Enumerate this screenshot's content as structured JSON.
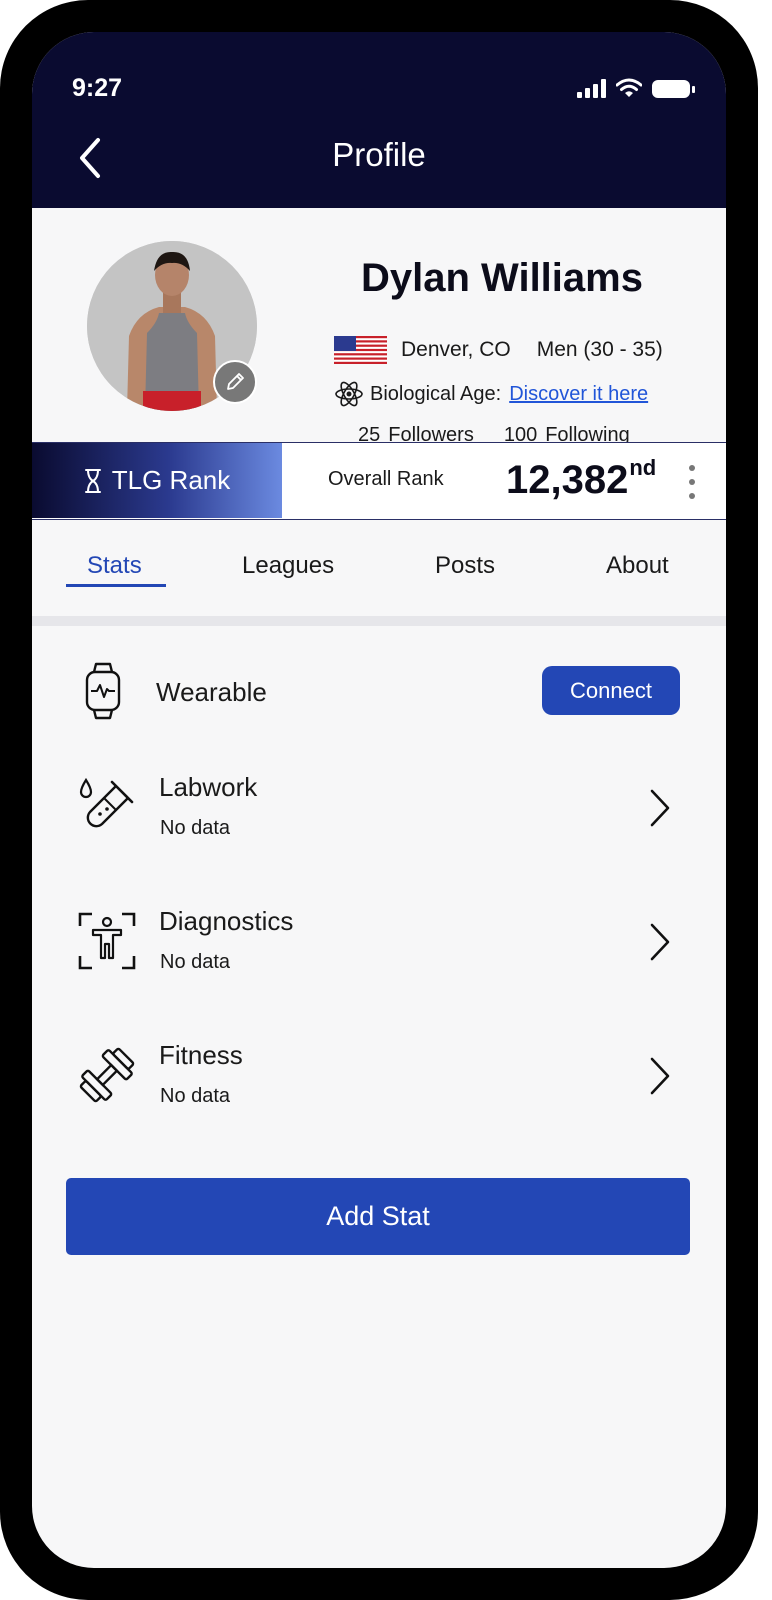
{
  "status_bar": {
    "time": "9:27"
  },
  "header": {
    "title": "Profile"
  },
  "profile": {
    "name": "Dylan Williams",
    "location": "Denver, CO",
    "age_group": "Men (30 - 35)",
    "bio_age_label": "Biological Age:",
    "bio_age_link": "Discover it here",
    "followers_count": "25",
    "followers_label": "Followers",
    "following_count": "100",
    "following_label": "Following"
  },
  "rank": {
    "label": "TLG Rank",
    "overall_label": "Overall Rank",
    "value": "12,382",
    "suffix": "nd"
  },
  "tabs": [
    {
      "label": "Stats",
      "active": true
    },
    {
      "label": "Leagues",
      "active": false
    },
    {
      "label": "Posts",
      "active": false
    },
    {
      "label": "About",
      "active": false
    }
  ],
  "stats": {
    "wearable": {
      "title": "Wearable",
      "action": "Connect",
      "icon": "smartwatch-icon"
    },
    "items": [
      {
        "title": "Labwork",
        "subtitle": "No data",
        "icon": "test-tube-icon"
      },
      {
        "title": "Diagnostics",
        "subtitle": "No data",
        "icon": "body-scan-icon"
      },
      {
        "title": "Fitness",
        "subtitle": "No data",
        "icon": "dumbbell-icon"
      }
    ]
  },
  "add_stat_label": "Add Stat",
  "colors": {
    "header_bg": "#0a0b30",
    "accent": "#2347b5",
    "link": "#2155d8"
  }
}
